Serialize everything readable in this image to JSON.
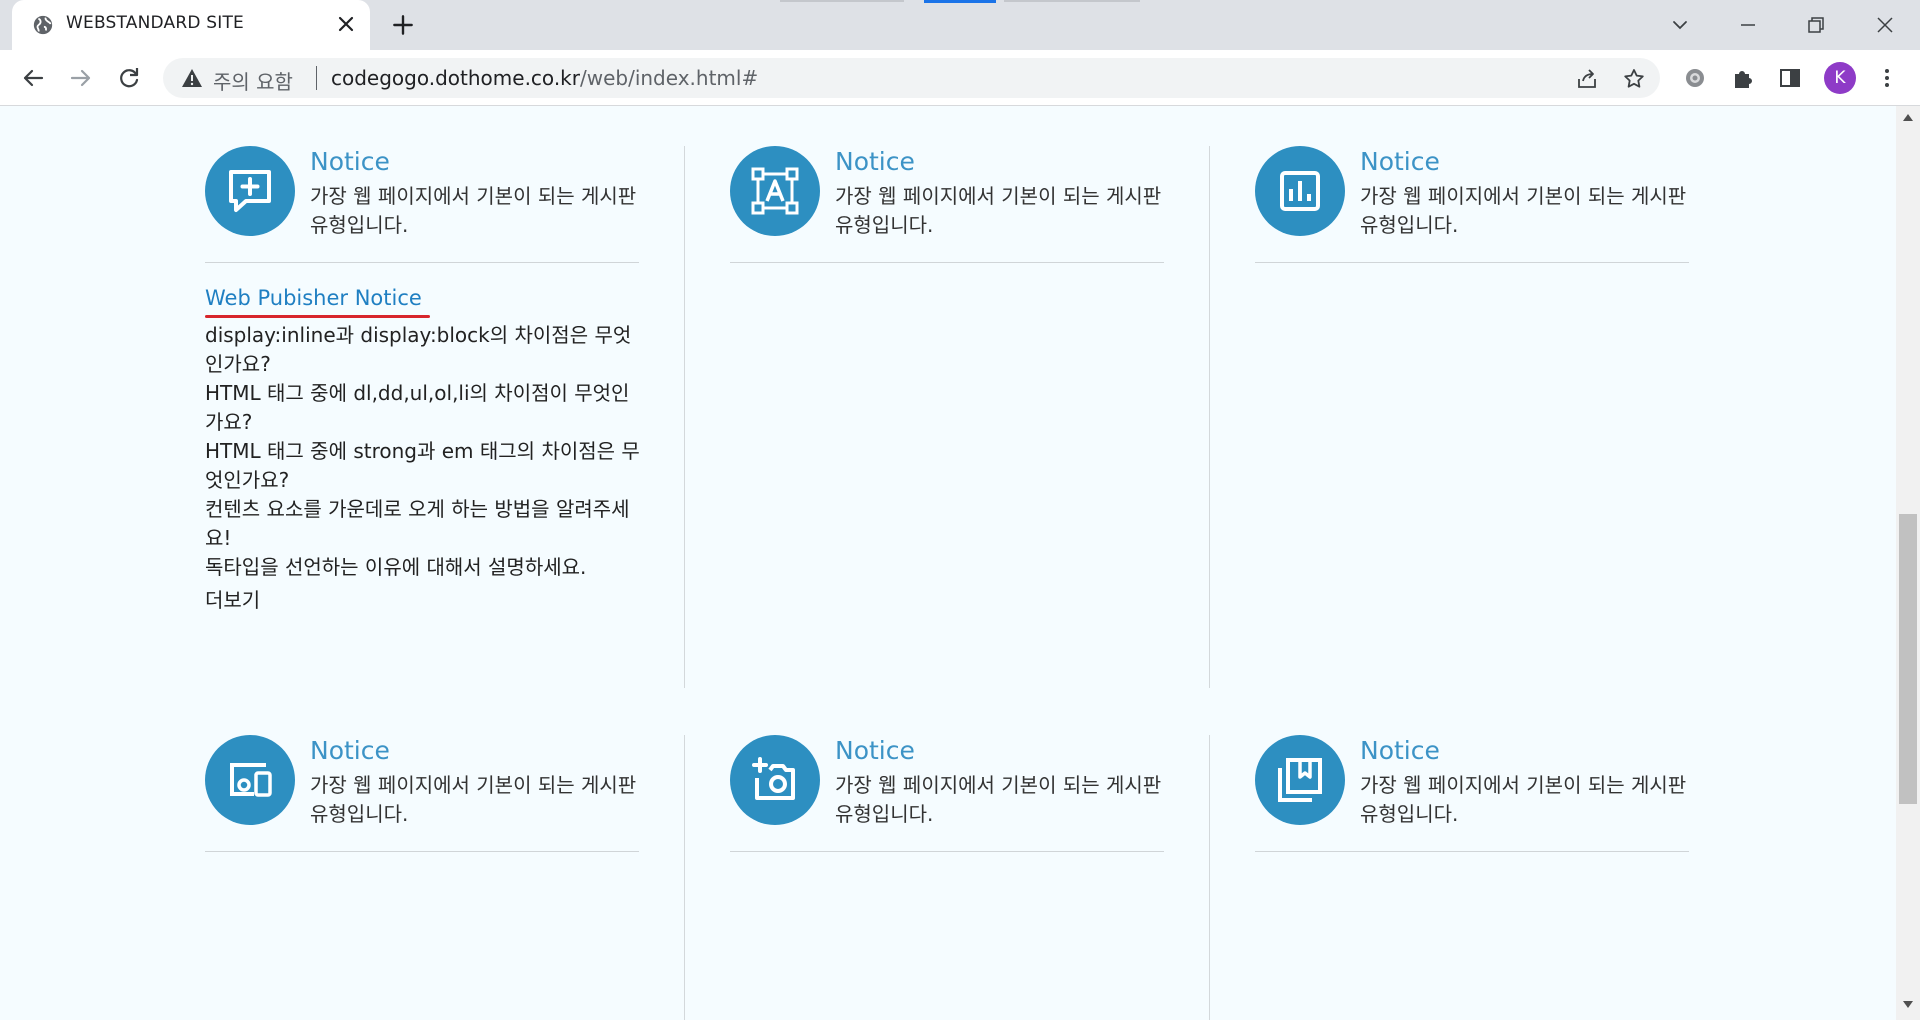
{
  "browser": {
    "tab_title": "WEBSTANDARD SITE",
    "security_label": "주의 요함",
    "url_host": "codegogo.dothome.co.kr",
    "url_path": "/web/index.html#",
    "profile_initial": "K"
  },
  "cards": [
    {
      "title": "Notice",
      "description": "가장 웹 페이지에서 기본이 되는 게시판 유형입니다.",
      "icon": "message-plus-icon"
    },
    {
      "title": "Notice",
      "description": "가장 웹 페이지에서 기본이 되는 게시판 유형입니다.",
      "icon": "text-frame-icon"
    },
    {
      "title": "Notice",
      "description": "가장 웹 페이지에서 기본이 되는 게시판 유형입니다.",
      "icon": "bar-chart-icon"
    },
    {
      "title": "Notice",
      "description": "가장 웹 페이지에서 기본이 되는 게시판 유형입니다.",
      "icon": "devices-icon"
    },
    {
      "title": "Notice",
      "description": "가장 웹 페이지에서 기본이 되는 게시판 유형입니다.",
      "icon": "add-camera-icon"
    },
    {
      "title": "Notice",
      "description": "가장 웹 페이지에서 기본이 되는 게시판 유형입니다.",
      "icon": "bookmark-library-icon"
    }
  ],
  "notice": {
    "heading": "Web Pubisher Notice",
    "items": [
      "display:inline과 display:block의 차이점은 무엇인가요?",
      "HTML 태그 중에 dl,dd,ul,ol,li의 차이점이 무엇인가요?",
      "HTML 태그 중에 strong과 em 태그의 차이점은 무엇인가요?",
      "컨텐츠 요소를 가운데로 오게 하는 방법을 알려주세요!",
      "독타입을 선언하는 이유에 대해서 설명하세요."
    ],
    "more_label": "더보기"
  },
  "colors": {
    "accent_blue": "#2d8fc1",
    "title_blue": "#3c93c6",
    "underline_red": "#d7262c",
    "page_bg": "#f5fcff"
  }
}
